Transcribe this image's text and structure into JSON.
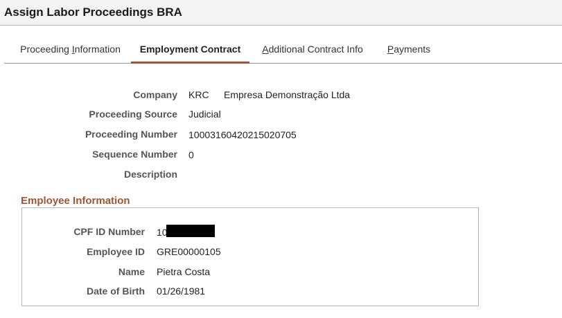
{
  "page": {
    "title": "Assign Labor Proceedings BRA"
  },
  "tabs": [
    {
      "label_pre": "Proceeding ",
      "label_u": "I",
      "label_post": "nformation",
      "active": false
    },
    {
      "label_pre": "Employment Contract",
      "label_u": "",
      "label_post": "",
      "active": true
    },
    {
      "label_pre": "",
      "label_u": "A",
      "label_post": "dditional Contract Info",
      "active": false
    },
    {
      "label_pre": "",
      "label_u": "P",
      "label_post": "ayments",
      "active": false
    }
  ],
  "proceeding": {
    "company_label": "Company",
    "company_code": "KRC",
    "company_name": "Empresa Demonstração Ltda",
    "source_label": "Proceeding Source",
    "source_value": "Judicial",
    "number_label": "Proceeding Number",
    "number_value": "10003160420215020705",
    "sequence_label": "Sequence Number",
    "sequence_value": "0",
    "description_label": "Description",
    "description_value": ""
  },
  "employee": {
    "section_title": "Employee Information",
    "cpf_label": "CPF ID Number",
    "cpf_value_visible": "10",
    "employee_id_label": "Employee ID",
    "employee_id_value": "GRE00000105",
    "name_label": "Name",
    "name_value": "Pietra Costa",
    "dob_label": "Date of Birth",
    "dob_value": "01/26/1981"
  },
  "colors": {
    "accent": "#9e5533",
    "title_bar": "#f3f3f3",
    "redaction": "#000000"
  }
}
